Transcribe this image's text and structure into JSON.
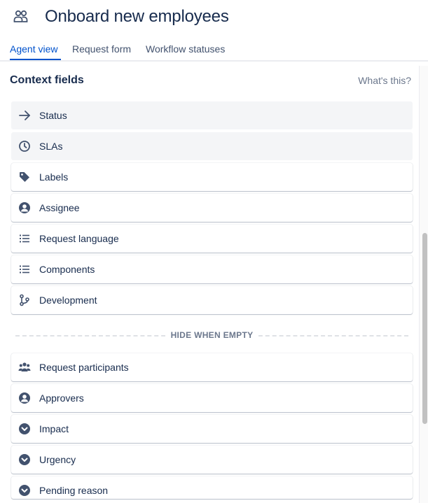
{
  "header": {
    "title": "Onboard new employees",
    "icon": "people-icon"
  },
  "tabs": [
    {
      "label": "Agent view",
      "active": true
    },
    {
      "label": "Request form",
      "active": false
    },
    {
      "label": "Workflow statuses",
      "active": false
    }
  ],
  "section": {
    "title": "Context fields",
    "help_link": "What's this?"
  },
  "fields": [
    {
      "label": "Status",
      "icon": "arrow-right-icon",
      "locked": true
    },
    {
      "label": "SLAs",
      "icon": "clock-icon",
      "locked": true
    },
    {
      "label": "Labels",
      "icon": "tag-icon",
      "locked": false
    },
    {
      "label": "Assignee",
      "icon": "user-circle-icon",
      "locked": false
    },
    {
      "label": "Request language",
      "icon": "list-icon",
      "locked": false
    },
    {
      "label": "Components",
      "icon": "list-icon",
      "locked": false
    },
    {
      "label": "Development",
      "icon": "branch-icon",
      "locked": false
    }
  ],
  "divider": {
    "label": "HIDE WHEN EMPTY"
  },
  "hidden_fields": [
    {
      "label": "Request participants",
      "icon": "people-group-icon"
    },
    {
      "label": "Approvers",
      "icon": "user-circle-icon"
    },
    {
      "label": "Impact",
      "icon": "chevron-circle-icon"
    },
    {
      "label": "Urgency",
      "icon": "chevron-circle-icon"
    },
    {
      "label": "Pending reason",
      "icon": "chevron-circle-icon"
    }
  ],
  "colors": {
    "accent": "#0052cc",
    "text": "#172b4d",
    "muted": "#6b778c",
    "icon": "#42526e"
  }
}
